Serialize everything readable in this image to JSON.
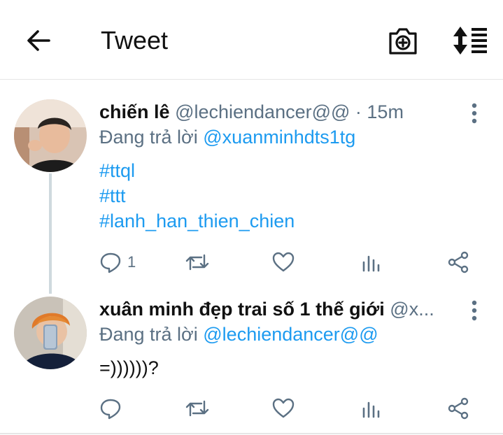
{
  "header": {
    "title": "Tweet",
    "back_icon": "arrow-left-icon",
    "camera_icon": "camera-plus-icon",
    "sort_icon": "sort-icon"
  },
  "tweets": [
    {
      "display_name": "chiến lê",
      "handle": "@lechiendancer@@",
      "separator": " · ",
      "time": "15m",
      "reply_prefix": "Đang trả lời ",
      "reply_to": "@xuanminhdts1tg",
      "body_lines": [
        "#ttql",
        "#ttt",
        "#lanh_han_thien_chien"
      ],
      "reply_count": "1"
    },
    {
      "display_name": "xuân minh đẹp trai số 1 thế giới",
      "handle": "@x...",
      "reply_prefix": "Đang trả lời ",
      "reply_to": "@lechiendancer@@",
      "body_text": "=))))))?"
    }
  ],
  "colors": {
    "link": "#1d9bf0",
    "secondary": "#5b7083",
    "divider": "#e6e6e6"
  }
}
